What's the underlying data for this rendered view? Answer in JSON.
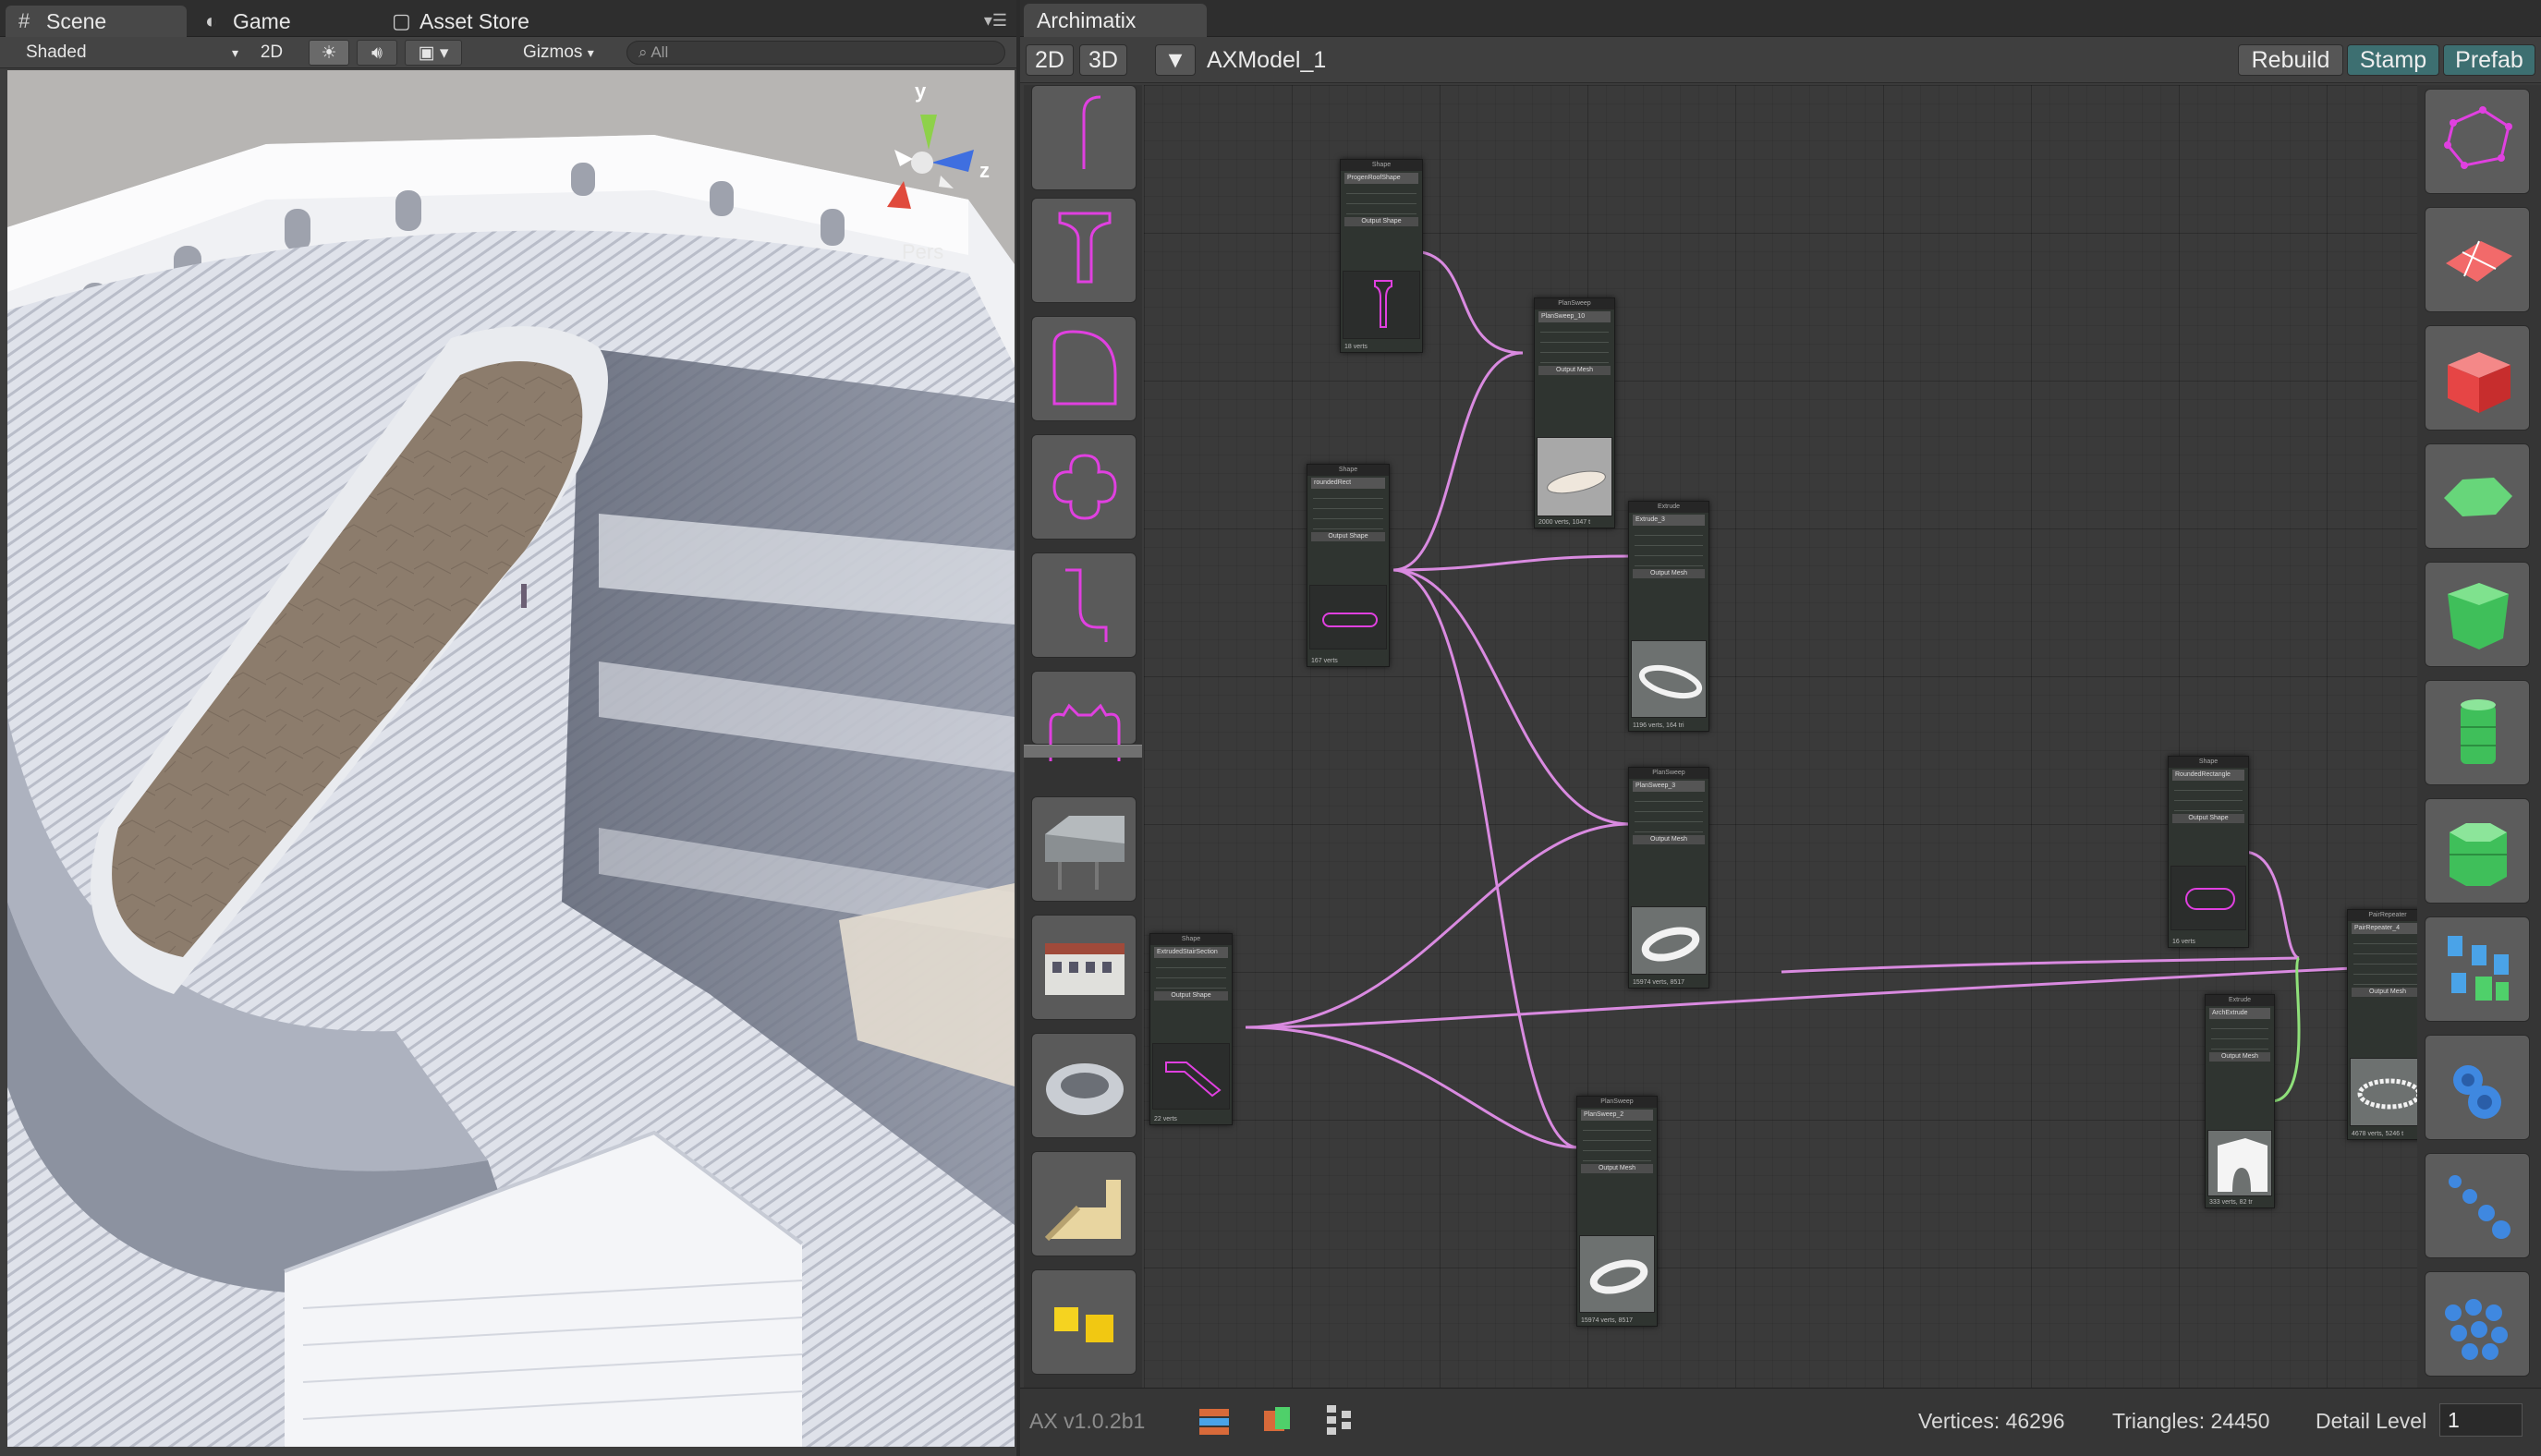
{
  "scene": {
    "tabs": [
      {
        "label": "Scene",
        "icon": "grid-icon"
      },
      {
        "label": "Game",
        "icon": "pacman-icon"
      },
      {
        "label": "Asset Store",
        "icon": "bag-icon"
      }
    ],
    "toolbar": {
      "shading_mode": "Shaded",
      "mode_2d": "2D",
      "gizmos": "Gizmos",
      "search_placeholder": "All"
    },
    "gizmo": {
      "y_label": "y",
      "z_label": "z",
      "projection": "Pers"
    }
  },
  "archimatix": {
    "tab_label": "Archimatix",
    "view_2d": "2D",
    "view_3d": "3D",
    "model_name": "AXModel_1",
    "buttons": {
      "rebuild": "Rebuild",
      "stamp": "Stamp",
      "prefab": "Prefab"
    },
    "left_palette": [
      "line-shape-icon",
      "i-beam-shape-icon",
      "arch-shape-icon",
      "quatrefoil-shape-icon",
      "s-curve-shape-icon",
      "crenellation-shape-icon",
      "truss-model-icon",
      "building-model-icon",
      "coliseum-ring-model-icon",
      "temple-stairs-model-icon",
      "boxes-model-icon"
    ],
    "right_palette": [
      "polygon-node-icon",
      "plane-node-icon",
      "cube-node-icon",
      "extrude-shape-node-icon",
      "polygon-prism-icon",
      "lathe-cylinder-icon",
      "lathe-octagon-icon",
      "grid-repeater-icon",
      "pair-repeater-icon",
      "linear-repeater-icon",
      "radial-repeater-icon"
    ],
    "nodes": [
      {
        "header": "Shape",
        "name": "ProgenRoofShape",
        "footer": "18 verts"
      },
      {
        "header": "PlanSweep",
        "name": "PlanSweep_10",
        "footer": "2000 verts, 1047 t"
      },
      {
        "header": "Shape",
        "name": "roundedRect",
        "footer": "167 verts"
      },
      {
        "header": "Extrude",
        "name": "Extrude_3",
        "footer": "1196 verts, 164 tri"
      },
      {
        "header": "PlanSweep",
        "name": "PlanSweep_3",
        "footer": "15974 verts, 8517"
      },
      {
        "header": "Shape",
        "name": "RoundedRectangle",
        "footer": "16 verts"
      },
      {
        "header": "Shape",
        "name": "ExtrudedStairSection",
        "footer": "22 verts"
      },
      {
        "header": "PlanSweep",
        "name": "PlanSweep_2",
        "footer": "15974 verts, 8517"
      },
      {
        "header": "Extrude",
        "name": "ArchExtrude",
        "footer": "333 verts, 82 tr"
      },
      {
        "header": "PairRepeater",
        "name": "PairRepeater_4",
        "footer": "4678 verts, 5246 t"
      }
    ],
    "status": {
      "version": "AX v1.0.2b1",
      "vertices": "Vertices: 46296",
      "triangles": "Triangles: 24450",
      "detail_label": "Detail Level",
      "detail_value": "1"
    },
    "colors": {
      "wire": "#d98ae0",
      "wire_green": "#8fe07a",
      "accent_teal": "#3d6f71",
      "shape_magenta": "#e040e0"
    }
  }
}
